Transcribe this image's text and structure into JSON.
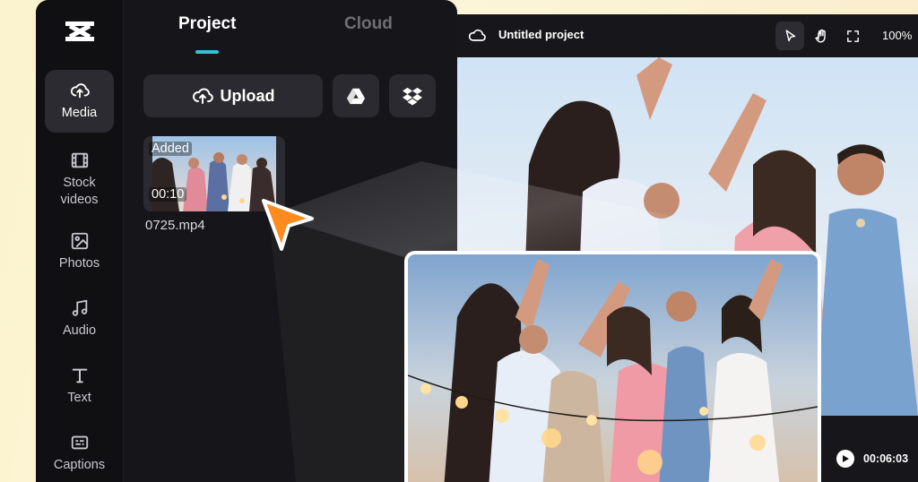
{
  "sidebar": {
    "logo": "capcut-logo",
    "items": [
      {
        "label": "Media",
        "icon": "cloud-upload-icon",
        "active": true
      },
      {
        "label": "Stock\nvideos",
        "icon": "film-icon",
        "active": false
      },
      {
        "label": "Photos",
        "icon": "image-icon",
        "active": false
      },
      {
        "label": "Audio",
        "icon": "music-note-icon",
        "active": false
      },
      {
        "label": "Text",
        "icon": "text-t-icon",
        "active": false
      },
      {
        "label": "Captions",
        "icon": "captions-icon",
        "active": false
      }
    ]
  },
  "panel": {
    "tabs": [
      {
        "label": "Project",
        "active": true
      },
      {
        "label": "Cloud",
        "active": false
      }
    ],
    "upload_label": "Upload",
    "drive_icon": "google-drive-icon",
    "dropbox_icon": "dropbox-icon",
    "media": [
      {
        "badge": "Added",
        "duration": "00:10",
        "filename": "0725.mp4"
      }
    ]
  },
  "editor": {
    "title": "Untitled project",
    "zoom": "100%",
    "tools": [
      "pointer-icon",
      "hand-icon",
      "fullscreen-icon"
    ],
    "time": "00:06:03"
  },
  "colors": {
    "accent": "#35c0d8",
    "cursor": "#ff8a1f",
    "background": "#fbf3cf",
    "panel": "#16161a"
  }
}
